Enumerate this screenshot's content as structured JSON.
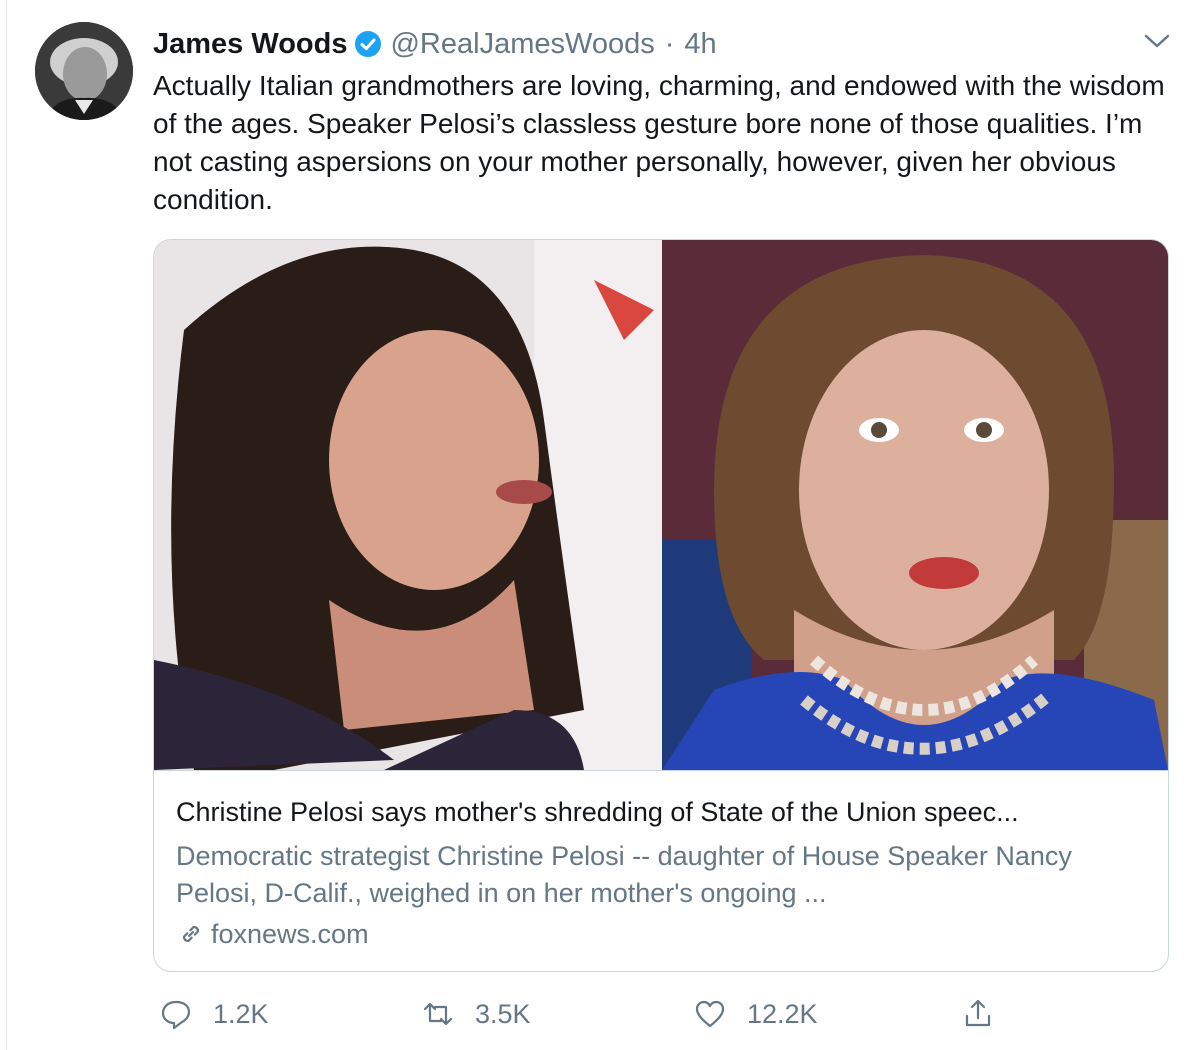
{
  "tweet": {
    "author_name": "James Woods",
    "handle": "@RealJamesWoods",
    "separator": "·",
    "time": "4h",
    "text": "Actually Italian grandmothers are loving, charming, and endowed with the wisdom of the ages. Speaker Pelosi’s classless gesture bore none of those qualities. I’m not casting aspersions on your mother personally, however, given her obvious condition."
  },
  "card": {
    "title": "Christine Pelosi says mother's shredding of State of the Union speec...",
    "description": "Democratic strategist Christine Pelosi -- daughter of House Speaker Nancy Pelosi, D-Calif., weighed in on her mother's ongoing ...",
    "domain": "foxnews.com"
  },
  "actions": {
    "reply_count": "1.2K",
    "retweet_count": "3.5K",
    "like_count": "12.2K"
  },
  "icons": {
    "verified": "verified-badge-icon",
    "caret": "chevron-down-icon",
    "link": "link-icon",
    "reply": "reply-icon",
    "retweet": "retweet-icon",
    "like": "heart-icon",
    "share": "share-icon"
  },
  "colors": {
    "accent": "#1da1f2",
    "secondary_text": "#657786",
    "border": "#ccd6dd"
  }
}
